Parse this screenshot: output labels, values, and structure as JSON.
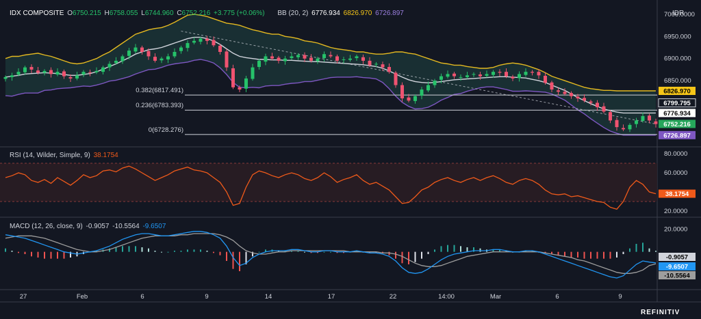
{
  "header": {
    "symbol": "IDX COMPOSITE",
    "o_label": "O",
    "o_value": "6750.215",
    "h_label": "H",
    "h_value": "6758.055",
    "l_label": "L",
    "l_value": "6744.960",
    "c_label": "C",
    "c_value": "6752.216",
    "change": "+3.775 (+0.06%)",
    "bb_label": "BB (20, 2)",
    "bb_mid": "6776.934",
    "bb_upper": "6826.970",
    "bb_lower": "6726.897",
    "currency": "IDR"
  },
  "rsi_header": {
    "label": "RSI (14, Wilder, Simple, 9)",
    "value": "38.1754"
  },
  "macd_header": {
    "label": "MACD (12, 26, close, 9)",
    "v1": "-0.9057",
    "v2": "-10.5564",
    "v3": "-9.6507"
  },
  "fib_levels": [
    {
      "label": "0.382(6817.491)",
      "value": 6817.491
    },
    {
      "label": "0.236(6783.393)",
      "value": 6783.393
    },
    {
      "label": "0(6728.276)",
      "value": 6728.276
    }
  ],
  "price_axis": {
    "ticks": [
      "7000.0000",
      "6950.000",
      "6900.000",
      "6850.000"
    ],
    "values": [
      7000,
      6950,
      6900,
      6850
    ]
  },
  "price_tags": [
    {
      "text": "6826.970",
      "value": 6826.97,
      "bg": "#f5c518",
      "fg": "#000000"
    },
    {
      "text": "6799.795",
      "value": 6799.795,
      "bg": "#131722",
      "fg": "#ffffff",
      "border": "#d1d4dc"
    },
    {
      "text": "6776.934",
      "value": 6776.934,
      "bg": "#ffffff",
      "fg": "#000000"
    },
    {
      "text": "6752.216",
      "value": 6752.216,
      "bg": "#26a65b",
      "fg": "#ffffff"
    },
    {
      "text": "6726.897",
      "value": 6726.897,
      "bg": "#7e57c2",
      "fg": "#ffffff"
    }
  ],
  "rsi_axis": {
    "ticks": [
      "80.0000",
      "60.0000",
      "20.0000"
    ],
    "values": [
      80,
      60,
      20
    ]
  },
  "rsi_tag": {
    "text": "38.1754",
    "value": 38.1754,
    "bg": "#f05a1a",
    "fg": "#ffffff"
  },
  "macd_axis": {
    "ticks": [
      "20.0000"
    ],
    "values": [
      20
    ]
  },
  "macd_tags": [
    {
      "text": "-0.9057",
      "value": -0.9057,
      "bg": "#d1d4dc",
      "fg": "#000000"
    },
    {
      "text": "-9.6507",
      "value": -9.6507,
      "bg": "#2196f3",
      "fg": "#ffffff"
    },
    {
      "text": "-10.5564",
      "value": -10.5564,
      "bg": "#9e9e9e",
      "fg": "#000000"
    }
  ],
  "x_axis": [
    "27",
    "Feb",
    "6",
    "9",
    "14",
    "17",
    "22",
    "14:00",
    "Mar",
    "6",
    "9"
  ],
  "brand": "REFINITIV",
  "colors": {
    "up": "#26c26a",
    "down": "#ef5370",
    "bb_band": "#e5b920",
    "bb_lower": "#7e57c2",
    "rsi": "#f05a1a",
    "macd": "#2196f3",
    "signal": "#9e9e9e",
    "fill": "#1d3b3a"
  },
  "chart_data": [
    {
      "type": "candlestick",
      "title": "IDX COMPOSITE",
      "ylim": [
        6705,
        7020
      ],
      "note_ohlc_last": {
        "open": 6750.215,
        "high": 6758.055,
        "low": 6744.96,
        "close": 6752.216
      },
      "close": [
        6858,
        6862,
        6870,
        6880,
        6875,
        6868,
        6872,
        6865,
        6870,
        6860,
        6855,
        6862,
        6870,
        6868,
        6872,
        6880,
        6888,
        6895,
        6905,
        6918,
        6925,
        6915,
        6905,
        6895,
        6900,
        6905,
        6915,
        6925,
        6935,
        6940,
        6945,
        6940,
        6930,
        6915,
        6880,
        6835,
        6830,
        6855,
        6880,
        6895,
        6905,
        6900,
        6895,
        6900,
        6905,
        6908,
        6900,
        6895,
        6900,
        6910,
        6905,
        6895,
        6898,
        6900,
        6905,
        6895,
        6885,
        6888,
        6880,
        6870,
        6840,
        6810,
        6805,
        6815,
        6830,
        6840,
        6850,
        6860,
        6865,
        6860,
        6858,
        6862,
        6865,
        6860,
        6865,
        6870,
        6868,
        6860,
        6855,
        6865,
        6870,
        6868,
        6862,
        6845,
        6830,
        6825,
        6820,
        6815,
        6810,
        6805,
        6800,
        6790,
        6780,
        6760,
        6745,
        6740,
        6750,
        6760,
        6770,
        6760,
        6752
      ],
      "bb_upper": [
        6900,
        6905,
        6905,
        6908,
        6910,
        6912,
        6908,
        6905,
        6900,
        6895,
        6890,
        6888,
        6890,
        6895,
        6900,
        6908,
        6915,
        6925,
        6935,
        6945,
        6955,
        6960,
        6965,
        6968,
        6970,
        6975,
        6982,
        6990,
        6998,
        7000,
        6998,
        6995,
        6990,
        6985,
        6980,
        6978,
        6975,
        6970,
        6965,
        6962,
        6958,
        6955,
        6955,
        6950,
        6948,
        6945,
        6940,
        6938,
        6935,
        6930,
        6925,
        6922,
        6920,
        6918,
        6915,
        6915,
        6912,
        6910,
        6910,
        6912,
        6915,
        6915,
        6912,
        6910,
        6905,
        6900,
        6895,
        6890,
        6888,
        6885,
        6885,
        6882,
        6880,
        6878,
        6878,
        6880,
        6885,
        6888,
        6890,
        6888,
        6885,
        6880,
        6875,
        6868,
        6860,
        6855,
        6850,
        6845,
        6840,
        6835,
        6832,
        6830,
        6828,
        6828,
        6827,
        6827,
        6827,
        6827,
        6827,
        6827,
        6827
      ],
      "bb_mid": [
        6858,
        6860,
        6862,
        6865,
        6866,
        6867,
        6868,
        6867,
        6866,
        6864,
        6862,
        6862,
        6864,
        6866,
        6870,
        6876,
        6882,
        6888,
        6895,
        6902,
        6910,
        6915,
        6920,
        6922,
        6925,
        6930,
        6935,
        6940,
        6945,
        6948,
        6948,
        6945,
        6940,
        6932,
        6922,
        6912,
        6905,
        6902,
        6900,
        6898,
        6898,
        6897,
        6897,
        6896,
        6896,
        6895,
        6894,
        6893,
        6893,
        6892,
        6891,
        6890,
        6889,
        6888,
        6887,
        6886,
        6884,
        6882,
        6878,
        6872,
        6865,
        6858,
        6852,
        6848,
        6846,
        6845,
        6846,
        6848,
        6850,
        6852,
        6853,
        6854,
        6855,
        6856,
        6857,
        6858,
        6859,
        6859,
        6858,
        6857,
        6856,
        6853,
        6850,
        6846,
        6840,
        6834,
        6828,
        6820,
        6812,
        6805,
        6798,
        6792,
        6786,
        6782,
        6779,
        6777,
        6777,
        6777,
        6777,
        6777,
        6777
      ],
      "bb_lower": [
        6816,
        6815,
        6819,
        6822,
        6822,
        6822,
        6828,
        6829,
        6832,
        6833,
        6834,
        6836,
        6838,
        6837,
        6840,
        6844,
        6849,
        6851,
        6855,
        6859,
        6865,
        6870,
        6875,
        6876,
        6880,
        6885,
        6888,
        6890,
        6892,
        6896,
        6898,
        6895,
        6890,
        6879,
        6864,
        6846,
        6835,
        6834,
        6835,
        6834,
        6838,
        6839,
        6839,
        6842,
        6844,
        6845,
        6848,
        6848,
        6851,
        6854,
        6857,
        6858,
        6858,
        6858,
        6859,
        6857,
        6856,
        6854,
        6846,
        6832,
        6815,
        6801,
        6792,
        6786,
        6787,
        6790,
        6797,
        6806,
        6812,
        6819,
        6821,
        6826,
        6830,
        6834,
        6836,
        6836,
        6833,
        6830,
        6826,
        6826,
        6827,
        6826,
        6825,
        6824,
        6820,
        6813,
        6806,
        6795,
        6784,
        6775,
        6764,
        6754,
        6744,
        6736,
        6731,
        6727,
        6727,
        6727,
        6727,
        6727,
        6727
      ]
    },
    {
      "type": "line",
      "title": "RSI (14, Wilder, Simple, 9)",
      "ylim": [
        15,
        85
      ],
      "series": [
        {
          "name": "RSI",
          "values": [
            55,
            57,
            60,
            58,
            52,
            50,
            53,
            49,
            55,
            51,
            47,
            52,
            58,
            55,
            57,
            62,
            63,
            61,
            65,
            67,
            64,
            60,
            56,
            52,
            55,
            58,
            62,
            64,
            66,
            63,
            62,
            60,
            55,
            50,
            40,
            26,
            28,
            45,
            58,
            62,
            60,
            57,
            55,
            58,
            60,
            58,
            54,
            52,
            55,
            60,
            56,
            50,
            53,
            55,
            58,
            52,
            48,
            50,
            46,
            42,
            35,
            28,
            29,
            35,
            42,
            45,
            50,
            53,
            55,
            52,
            50,
            53,
            55,
            52,
            55,
            57,
            54,
            50,
            48,
            52,
            54,
            52,
            48,
            42,
            38,
            37,
            38,
            35,
            36,
            34,
            32,
            30,
            29,
            24,
            22,
            30,
            45,
            52,
            48,
            40,
            38.1754
          ]
        }
      ]
    },
    {
      "type": "line",
      "title": "MACD (12, 26, close, 9)",
      "ylim": [
        -32,
        28
      ],
      "series": [
        {
          "name": "MACD",
          "values": [
            15,
            14,
            13,
            12,
            10,
            8,
            6,
            4,
            2,
            0,
            -1,
            -2,
            -1,
            0,
            1,
            3,
            5,
            8,
            11,
            13,
            15,
            16,
            16,
            15,
            14,
            14,
            15,
            16,
            17,
            18,
            18,
            17,
            15,
            12,
            5,
            -5,
            -12,
            -10,
            -5,
            -2,
            0,
            1,
            1,
            1,
            2,
            2,
            1,
            0,
            0,
            1,
            1,
            0,
            0,
            0,
            1,
            0,
            -1,
            -1,
            -2,
            -4,
            -8,
            -14,
            -18,
            -19,
            -18,
            -15,
            -11,
            -7,
            -4,
            -2,
            -1,
            0,
            1,
            1,
            1,
            2,
            2,
            1,
            0,
            0,
            1,
            1,
            0,
            -2,
            -4,
            -6,
            -8,
            -10,
            -12,
            -14,
            -16,
            -18,
            -20,
            -22,
            -23,
            -21,
            -16,
            -11,
            -8,
            -9,
            -9.6507
          ]
        },
        {
          "name": "Signal",
          "values": [
            12,
            13,
            14,
            14,
            14,
            13,
            12,
            10,
            8,
            6,
            4,
            2,
            1,
            0,
            0,
            1,
            2,
            4,
            6,
            8,
            10,
            12,
            13,
            14,
            14,
            14,
            14,
            15,
            15,
            16,
            16,
            16,
            16,
            15,
            13,
            10,
            5,
            1,
            -1,
            -2,
            -2,
            -1,
            0,
            0,
            1,
            1,
            1,
            1,
            1,
            1,
            1,
            1,
            1,
            0,
            0,
            0,
            0,
            0,
            -1,
            -1,
            -2,
            -4,
            -7,
            -10,
            -12,
            -13,
            -13,
            -12,
            -10,
            -8,
            -6,
            -4,
            -3,
            -2,
            -1,
            0,
            0,
            0,
            0,
            0,
            0,
            0,
            0,
            -1,
            -2,
            -3,
            -4,
            -5,
            -7,
            -8,
            -10,
            -12,
            -14,
            -16,
            -18,
            -19,
            -19,
            -18,
            -16,
            -12,
            -10.5564
          ]
        }
      ]
    }
  ]
}
